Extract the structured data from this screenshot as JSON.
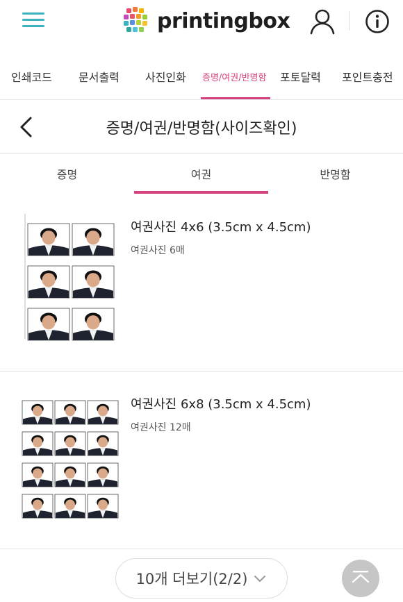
{
  "header": {
    "logo_text": "printingbox",
    "menu_icon": "hamburger-menu-icon",
    "user_icon": "user-icon",
    "info_icon": "info-icon",
    "accent_color": "#d6407f",
    "menu_color": "#3bb3c3"
  },
  "categories": [
    {
      "label": "인쇄코드"
    },
    {
      "label": "문서출력"
    },
    {
      "label": "사진인화"
    },
    {
      "label": "증명/여권/반명함",
      "active": true
    },
    {
      "label": "포토달력"
    },
    {
      "label": "포인트충전"
    }
  ],
  "page": {
    "title": "증명/여권/반명함(사이즈확인)",
    "back_icon": "back-arrow-icon"
  },
  "subtabs": [
    {
      "label": "증명"
    },
    {
      "label": "여권",
      "active": true
    },
    {
      "label": "반명함"
    }
  ],
  "products": [
    {
      "title": "여권사진 4x6 (3.5cm x 4.5cm)",
      "subtitle": "여권사진 6매"
    },
    {
      "title": "여권사진 6x8 (3.5cm x 4.5cm)",
      "subtitle": "여권사진 12매"
    }
  ],
  "footer": {
    "more_label": "10개 더보기(2/2)",
    "top_icon": "scroll-to-top-icon"
  }
}
